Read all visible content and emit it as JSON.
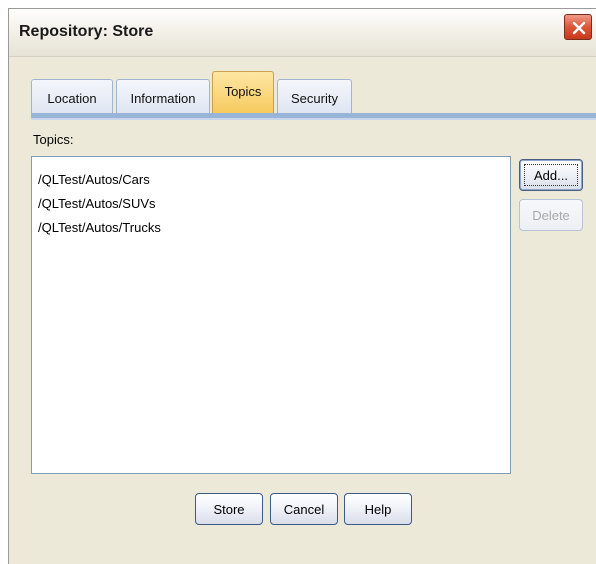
{
  "window": {
    "title": "Repository: Store"
  },
  "tabs": [
    {
      "label": "Location"
    },
    {
      "label": "Information"
    },
    {
      "label": "Topics"
    },
    {
      "label": "Security"
    }
  ],
  "active_tab": "Topics",
  "topics": {
    "label": "Topics:",
    "items": [
      "/QLTest/Autos/Cars",
      "/QLTest/Autos/SUVs",
      "/QLTest/Autos/Trucks"
    ],
    "add_button": "Add...",
    "delete_button": "Delete"
  },
  "footer": {
    "store": "Store",
    "cancel": "Cancel",
    "help": "Help"
  },
  "icons": {
    "close": "close-icon"
  },
  "colors": {
    "active_tab": "#f7c95e",
    "tab_strip": "#98b4d6",
    "close_button": "#dc5639"
  }
}
